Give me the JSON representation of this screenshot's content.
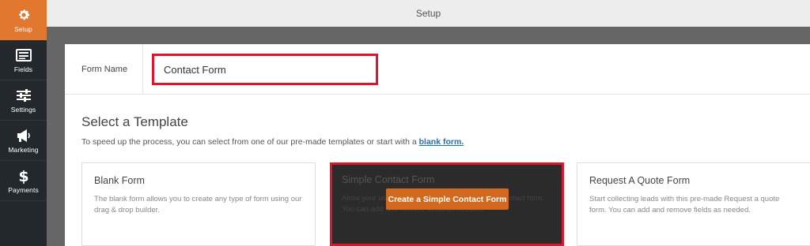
{
  "sidebar": {
    "items": [
      {
        "label": "Setup",
        "icon": "gear-icon"
      },
      {
        "label": "Fields",
        "icon": "fields-icon"
      },
      {
        "label": "Settings",
        "icon": "sliders-icon"
      },
      {
        "label": "Marketing",
        "icon": "megaphone-icon"
      },
      {
        "label": "Payments",
        "icon": "dollar-icon"
      }
    ],
    "active": "Setup",
    "active_color": "#e27730"
  },
  "topbar": {
    "title": "Setup"
  },
  "form_name": {
    "label": "Form Name",
    "value": "Contact Form"
  },
  "templates": {
    "title": "Select a Template",
    "subtitle": "To speed up the process, you can select from one of our pre-made templates or start with a",
    "subtitle_link": "blank form.",
    "cards": [
      {
        "title": "Blank Form",
        "desc": "The blank form allows you to create any type of form using our drag & drop builder."
      },
      {
        "title": "Simple Contact Form",
        "desc": "Allow your users to contact you with this simple contact form. You can add and remove fields as needed.",
        "button": "Create a Simple Contact Form"
      },
      {
        "title": "Request A Quote Form",
        "desc": "Start collecting leads with this pre-made Request a quote form. You can add and remove fields as needed."
      }
    ]
  },
  "colors": {
    "highlight": "#e0142a",
    "button": "#d2691e",
    "link": "#2271b1"
  }
}
